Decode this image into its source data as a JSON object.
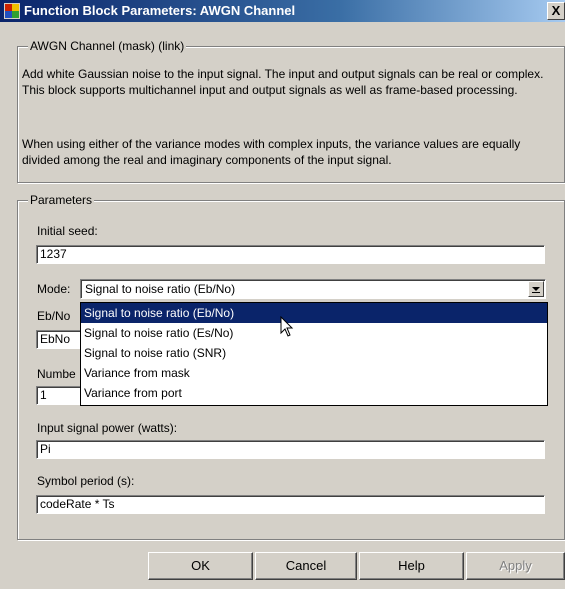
{
  "window": {
    "title": "Function Block Parameters: AWGN Channel",
    "close_label": "X"
  },
  "description_group": {
    "legend": "AWGN Channel (mask) (link)",
    "paragraph1": "Add white Gaussian noise to the input signal. The input and output signals can be real or complex. This block supports multichannel input and output signals as well as frame-based processing.",
    "paragraph2": "When using either of the variance modes with complex inputs, the variance values are equally divided among the real and imaginary components of the input signal."
  },
  "parameters": {
    "legend": "Parameters",
    "initial_seed_label": "Initial seed:",
    "initial_seed_value": "1237",
    "mode_label": "Mode:",
    "mode_value": "Signal to noise ratio  (Eb/No)",
    "mode_options": [
      "Signal to noise ratio  (Eb/No)",
      "Signal to noise ratio  (Es/No)",
      "Signal to noise ratio  (SNR)",
      "Variance from mask",
      "Variance from port"
    ],
    "ebno_label_partial": "Eb/No",
    "ebno_value_partial": "EbNo",
    "number_label_partial": "Numbe",
    "number_value": "1",
    "input_power_label": "Input signal power (watts):",
    "input_power_value": "Pi",
    "symbol_period_label": "Symbol period (s):",
    "symbol_period_value": "codeRate * Ts"
  },
  "buttons": {
    "ok": "OK",
    "cancel": "Cancel",
    "help": "Help",
    "apply": "Apply"
  }
}
